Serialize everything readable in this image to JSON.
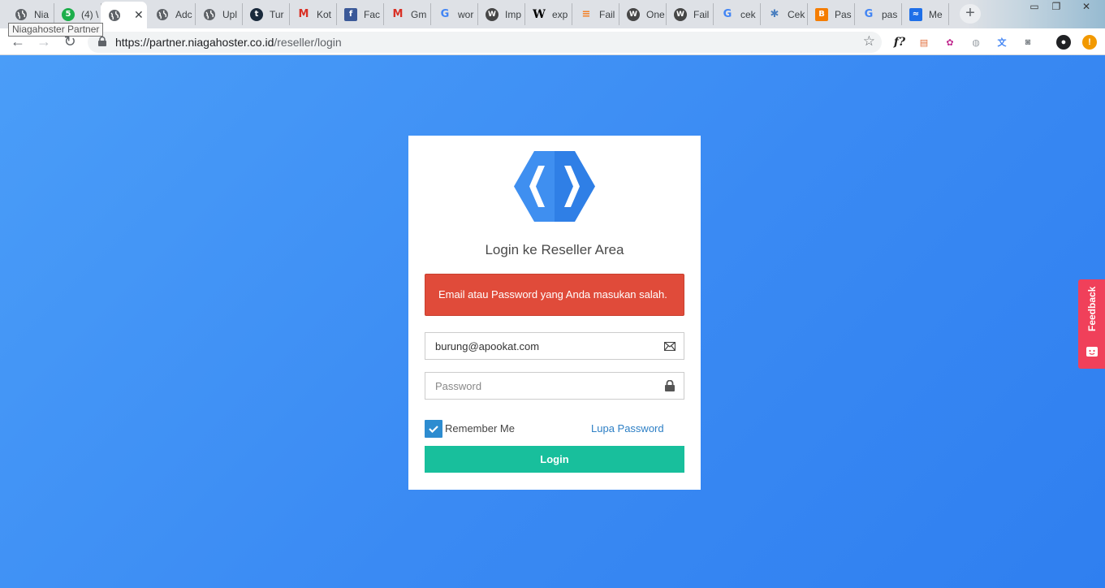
{
  "browser": {
    "tabs": [
      {
        "title": "Nia",
        "icon": "globe-icon",
        "color": "#5f6368"
      },
      {
        "title": "(4) \\",
        "icon": "badge-5-icon",
        "color": "#1dae4b",
        "glyph": "5"
      },
      {
        "title": "",
        "icon": "globe-icon",
        "color": "#5f6368",
        "active": true
      },
      {
        "title": "Adc",
        "icon": "globe-icon",
        "color": "#5f6368"
      },
      {
        "title": "Upl",
        "icon": "globe-icon",
        "color": "#5f6368"
      },
      {
        "title": "Tur",
        "icon": "tumblr-icon",
        "color": "#1a2a3c",
        "glyph": "t"
      },
      {
        "title": "Kot",
        "icon": "gmail-icon",
        "color": "#d93025",
        "glyph": "M"
      },
      {
        "title": "Fac",
        "icon": "facebook-icon",
        "color": "#3b5998",
        "glyph": "f"
      },
      {
        "title": "Gm",
        "icon": "gmail-icon",
        "color": "#d93025",
        "glyph": "M"
      },
      {
        "title": "wor",
        "icon": "google-icon",
        "color": "#4285f4",
        "glyph": "G"
      },
      {
        "title": "Imp",
        "icon": "wordpress-icon",
        "color": "#464646",
        "glyph": "W"
      },
      {
        "title": "exp",
        "icon": "wikipedia-icon",
        "color": "#000000",
        "glyph": "W"
      },
      {
        "title": "Fail",
        "icon": "stackoverflow-icon",
        "color": "#f48024",
        "glyph": "≡"
      },
      {
        "title": "One",
        "icon": "wordpress-icon",
        "color": "#464646",
        "glyph": "W"
      },
      {
        "title": "Fail",
        "icon": "wordpress-icon",
        "color": "#464646",
        "glyph": "W"
      },
      {
        "title": "cek",
        "icon": "google-icon",
        "color": "#4285f4",
        "glyph": "G"
      },
      {
        "title": "Cek",
        "icon": "network-icon",
        "color": "#4a7fbf",
        "glyph": "✱"
      },
      {
        "title": "Pas",
        "icon": "blogger-icon",
        "color": "#f57d00",
        "glyph": "B"
      },
      {
        "title": "pas",
        "icon": "google-icon",
        "color": "#4285f4",
        "glyph": "G"
      },
      {
        "title": "Me",
        "icon": "wave-icon",
        "color": "#1e6fe8",
        "glyph": "≈"
      }
    ],
    "tab_close": "✕",
    "new_tab": "+",
    "tooltip": "Niagahoster Partner",
    "url_host": "https://partner.niagahoster.co.id",
    "url_path": "/reseller/login",
    "back": "←",
    "forward": "→",
    "reload": "↻",
    "star": "☆",
    "window_controls": {
      "minimize": "▭",
      "restore": "❐",
      "close": "✕"
    },
    "extensions": [
      {
        "icon": "font-finder-icon",
        "glyph": "f?",
        "bg": "#ffffff",
        "color": "#222222"
      },
      {
        "icon": "calendar-icon",
        "glyph": "▤",
        "bg": "#ffffff",
        "color": "#e06c3a"
      },
      {
        "icon": "color-wheel-icon",
        "glyph": "✿",
        "bg": "#ffffff",
        "color": "#c0278d"
      },
      {
        "icon": "globe-gray-icon",
        "glyph": "◍",
        "bg": "#ffffff",
        "color": "#9aa0a6"
      },
      {
        "icon": "translate-icon",
        "glyph": "文",
        "bg": "#ffffff",
        "color": "#4285f4"
      },
      {
        "icon": "camera-icon",
        "glyph": "◙",
        "bg": "#ffffff",
        "color": "#80868b"
      },
      {
        "icon": "profile-icon",
        "glyph": "●",
        "bg": "#202124",
        "color": "#ffffff"
      },
      {
        "icon": "update-alert-icon",
        "glyph": "!",
        "bg": "#f29900",
        "color": "#ffffff"
      }
    ]
  },
  "login": {
    "title": "Login ke Reseller Area",
    "error": "Email atau Password yang Anda masukan salah.",
    "email_value": "burung@apookat.com",
    "password_placeholder": "Password",
    "remember_label": "Remember Me",
    "remember_checked": true,
    "forgot_link": "Lupa Password",
    "submit": "Login"
  },
  "feedback": {
    "label": "Feedback"
  },
  "colors": {
    "background": "#3b8cf5",
    "error": "#e04b3a",
    "login_button": "#18bf9c",
    "checkbox": "#2d8cd0",
    "link": "#2d7fc5",
    "feedback": "#f0405a",
    "logo_light": "#3f8ff0",
    "logo_dark": "#2f7fe6"
  }
}
